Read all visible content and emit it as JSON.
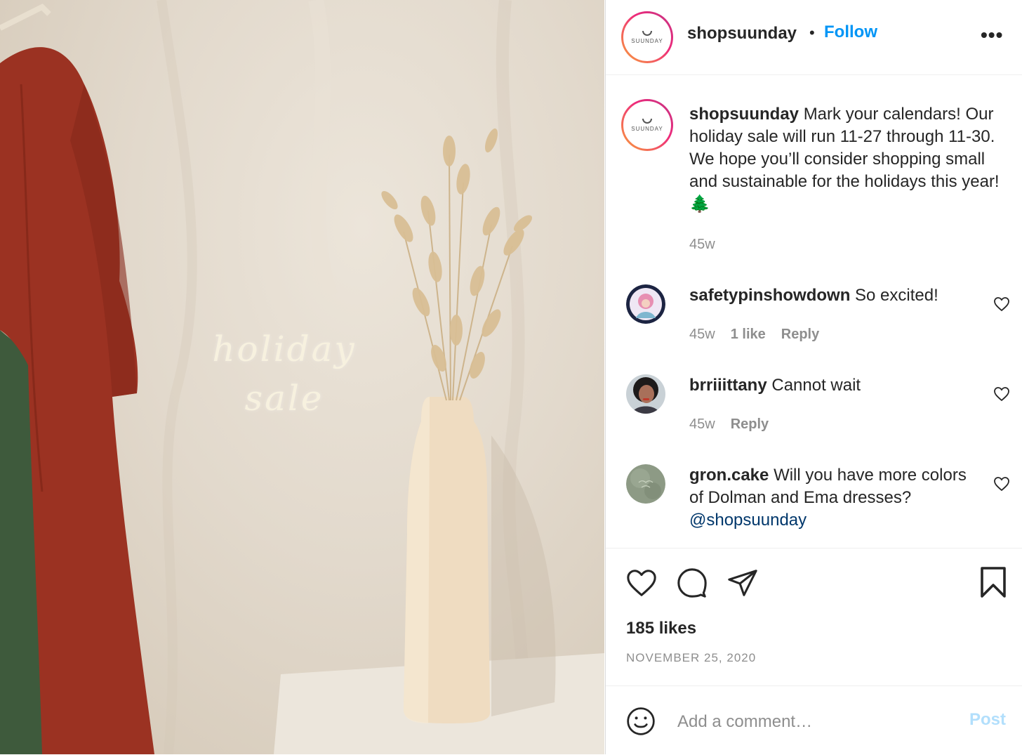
{
  "post": {
    "image_caption_line1": "holiday",
    "image_caption_line2": "sale"
  },
  "header": {
    "avatar_logo_text": "SUUNDAY",
    "username": "shopsuunday",
    "separator": "•",
    "follow_label": "Follow",
    "more_label": "•••"
  },
  "caption": {
    "username": "shopsuunday",
    "text": "Mark your calendars! Our holiday sale will run 11-27 through 11-30. We hope you’ll consider shopping small and sustainable for the holidays this year! 🌲",
    "time": "45w"
  },
  "comments": [
    {
      "username": "safetypinshowdown",
      "text": "So excited!",
      "time": "45w",
      "likes": "1 like",
      "reply_label": "Reply"
    },
    {
      "username": "brriiittany",
      "text": "Cannot wait",
      "time": "45w",
      "reply_label": "Reply"
    },
    {
      "username": "gron.cake",
      "text": "Will you have more colors of Dolman and Ema dresses?",
      "mention": "@shopsuunday"
    }
  ],
  "stats": {
    "likes": "185 likes",
    "date": "NOVEMBER 25, 2020"
  },
  "add_comment": {
    "placeholder": "Add a comment…",
    "post_label": "Post"
  },
  "colors": {
    "follow": "#0095f6",
    "post_disabled": "#b2dffc",
    "mention": "#00376b",
    "muted": "#8e8e8e"
  },
  "icons": [
    "more-icon",
    "heart-icon",
    "comment-icon",
    "share-icon",
    "bookmark-icon",
    "emoji-icon"
  ]
}
